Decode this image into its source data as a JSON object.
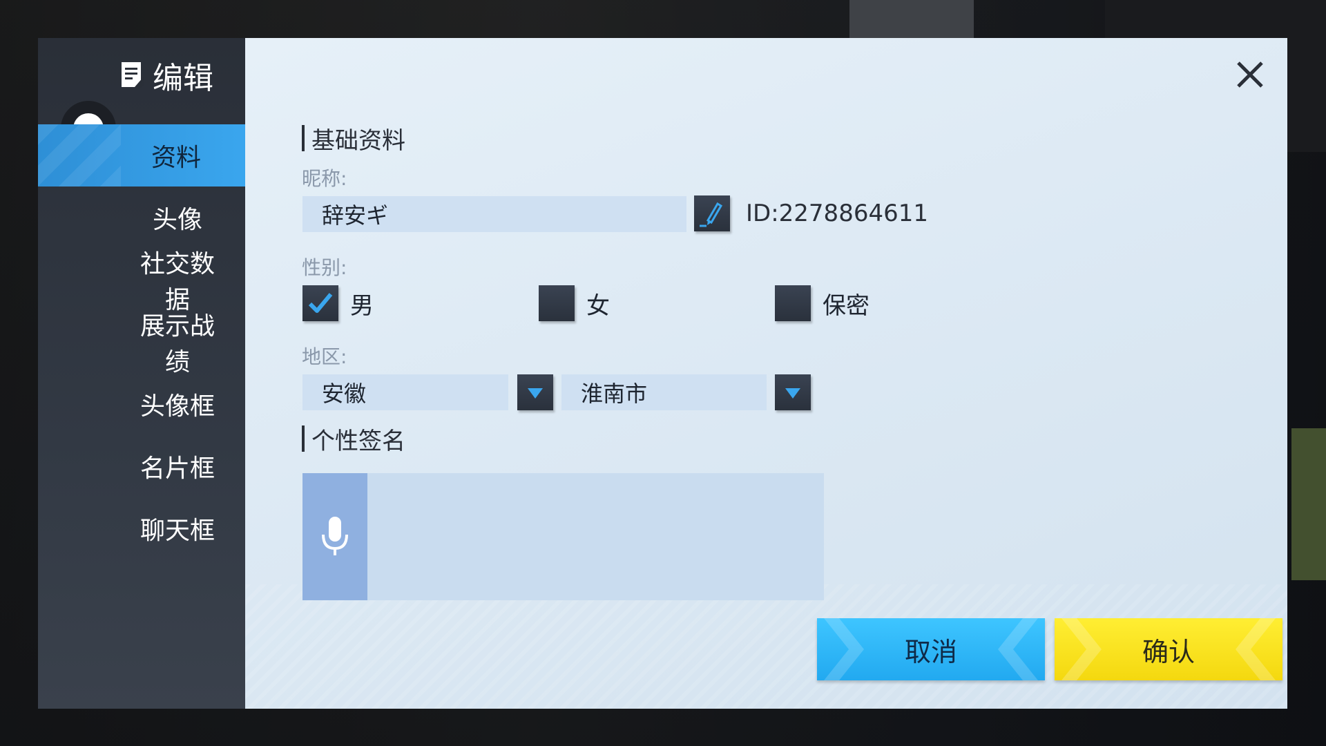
{
  "colors": {
    "sidebar_bg": "#2f3540",
    "active_tab": "#3aa6ee",
    "panel_bg": "#dbe8f3",
    "input_bg": "#cfe0f2",
    "cancel_button": "#2cb8f8",
    "confirm_button": "#f9e320",
    "mic_button": "#8fb0e0"
  },
  "sidebar": {
    "title": "编辑",
    "title_icon": "edit-document-icon",
    "items": [
      {
        "label": "资料",
        "active": true
      },
      {
        "label": "头像",
        "active": false
      },
      {
        "label": "社交数据",
        "active": false
      },
      {
        "label": "展示战绩",
        "active": false
      },
      {
        "label": "头像框",
        "active": false
      },
      {
        "label": "名片框",
        "active": false
      },
      {
        "label": "聊天框",
        "active": false
      }
    ]
  },
  "profile": {
    "section_title": "基础资料",
    "nickname_label": "昵称:",
    "nickname_value": "辞安ギ",
    "id_text": "ID:2278864611",
    "gender_label": "性别:",
    "gender_options": [
      {
        "label": "男",
        "checked": true
      },
      {
        "label": "女",
        "checked": false
      },
      {
        "label": "保密",
        "checked": false
      }
    ],
    "region_label": "地区:",
    "province": "安徽",
    "city": "淮南市"
  },
  "signature": {
    "section_title": "个性签名",
    "value": "",
    "mic_icon": "microphone-icon"
  },
  "actions": {
    "cancel_label": "取消",
    "confirm_label": "确认"
  },
  "icons": {
    "close": "close-icon",
    "edit": "pencil-icon",
    "dropdown": "triangle-down-icon",
    "check": "checkmark-icon"
  }
}
